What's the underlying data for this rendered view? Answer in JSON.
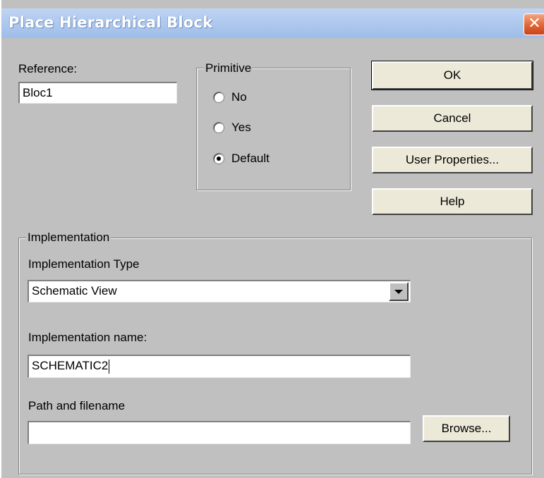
{
  "window": {
    "title": "Place Hierarchical Block",
    "close_symbol": "✕"
  },
  "reference": {
    "label": "Reference:",
    "value": "Bloc1"
  },
  "primitive": {
    "legend": "Primitive",
    "options": [
      "No",
      "Yes",
      "Default"
    ],
    "selected": "Default"
  },
  "buttons": {
    "ok": "OK",
    "cancel": "Cancel",
    "user_properties": "User Properties...",
    "help": "Help",
    "browse": "Browse..."
  },
  "implementation": {
    "legend": "Implementation",
    "type_label": "Implementation Type",
    "type_value": "Schematic View",
    "name_label": "Implementation name:",
    "name_value": "SCHEMATIC2",
    "path_label": "Path and filename",
    "path_value": ""
  },
  "icons": {
    "close": "close-icon",
    "dropdown": "chevron-down-icon",
    "radio": "radio-icon"
  },
  "colors": {
    "dialog_bg": "#c0c0c0",
    "titlebar": "#b0c9ee",
    "close_button": "#e36a3a"
  }
}
